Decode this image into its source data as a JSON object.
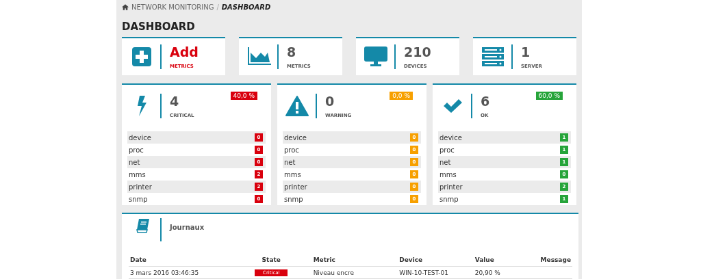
{
  "breadcrumb": {
    "items": [
      "NETWORK MONITORING",
      "DASHBOARD"
    ],
    "separator": "/"
  },
  "page_title": "DASHBOARD",
  "stat_cards": [
    {
      "kind": "add",
      "value": "Add",
      "label": "METRICS"
    },
    {
      "kind": "chart",
      "value": "8",
      "label": "METRICS"
    },
    {
      "kind": "monitor",
      "value": "210",
      "label": "DEVICES"
    },
    {
      "kind": "server",
      "value": "1",
      "label": "SERVER"
    }
  ],
  "status_panels": [
    {
      "kind": "critical",
      "color": "#d9000d",
      "count": "4",
      "label": "CRITICAL",
      "percent": "40,0 %",
      "rows": [
        {
          "name": "device",
          "count": "0"
        },
        {
          "name": "proc",
          "count": "0"
        },
        {
          "name": "net",
          "count": "0"
        },
        {
          "name": "mms",
          "count": "2"
        },
        {
          "name": "printer",
          "count": "2"
        },
        {
          "name": "snmp",
          "count": "0"
        }
      ]
    },
    {
      "kind": "warning",
      "color": "#f7a000",
      "count": "0",
      "label": "WARNING",
      "percent": "0,0 %",
      "rows": [
        {
          "name": "device",
          "count": "0"
        },
        {
          "name": "proc",
          "count": "0"
        },
        {
          "name": "net",
          "count": "0"
        },
        {
          "name": "mms",
          "count": "0"
        },
        {
          "name": "printer",
          "count": "0"
        },
        {
          "name": "snmp",
          "count": "0"
        }
      ]
    },
    {
      "kind": "ok",
      "color": "#26a43a",
      "count": "6",
      "label": "OK",
      "percent": "60,0 %",
      "rows": [
        {
          "name": "device",
          "count": "1"
        },
        {
          "name": "proc",
          "count": "1"
        },
        {
          "name": "net",
          "count": "1"
        },
        {
          "name": "mms",
          "count": "0"
        },
        {
          "name": "printer",
          "count": "2"
        },
        {
          "name": "snmp",
          "count": "1"
        }
      ]
    }
  ],
  "journal": {
    "title": "Journaux",
    "columns": [
      "Date",
      "State",
      "Metric",
      "Device",
      "Value",
      "Message"
    ],
    "rows": [
      {
        "date": "3 mars 2016 03:46:35",
        "state": "Critical",
        "metric": "Niveau encre",
        "device": "WIN-10-TEST-01",
        "value": "20,90 %"
      }
    ]
  }
}
